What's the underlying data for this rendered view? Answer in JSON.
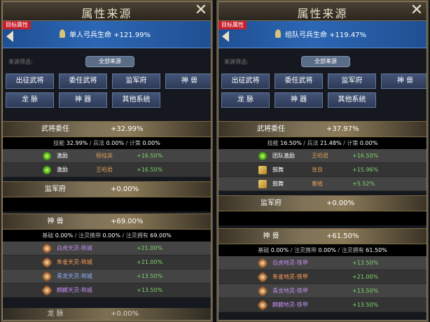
{
  "panels": [
    {
      "title": "属性来源",
      "target_tag": "目标属性",
      "target_stat": "单人弓兵生命 +121.99%",
      "filter_label": "来源筛选:",
      "all_sources": "全部来源",
      "filters": [
        "出征武将",
        "委任武将",
        "监军府",
        "神 兽",
        "龙 脉",
        "神 器",
        "其他系统"
      ],
      "sections": [
        {
          "name": "武将委任",
          "value": "+32.99%",
          "breakdown": [
            "技能",
            "32.99%",
            "/ 兵法",
            "0.00%",
            "/ 计策",
            "0.00%"
          ],
          "rows": [
            {
              "label": "激励",
              "name": "穆桂英",
              "value": "+16.50%",
              "icon": "green",
              "name_color": "orange"
            },
            {
              "label": "激励",
              "name": "王昭君",
              "value": "+16.50%",
              "icon": "green",
              "name_color": "orange"
            }
          ]
        },
        {
          "name": "监军府",
          "value": "+0.00%",
          "breakdown": [],
          "rows": []
        },
        {
          "name": "神 兽",
          "value": "+69.00%",
          "breakdown": [
            "基础",
            "0.00%",
            "/ 注灵携带",
            "0.00%",
            "/ 注灵拥有",
            "69.00%"
          ],
          "rows": [
            {
              "label": "白虎天灵-筑城",
              "name": "",
              "value": "+21.00%",
              "icon": "creature",
              "name_color": "purple"
            },
            {
              "label": "朱雀天灵-筑城",
              "name": "",
              "value": "+21.00%",
              "icon": "creature",
              "name_color": "orange"
            },
            {
              "label": "青龙天灵-筑城",
              "name": "",
              "value": "+13.50%",
              "icon": "creature",
              "name_color": "blue"
            },
            {
              "label": "麒麟天灵-筑城",
              "name": "",
              "value": "+13.50%",
              "icon": "creature",
              "name_color": "purple"
            }
          ]
        },
        {
          "name": "龙 脉",
          "value": "+0.00%",
          "breakdown": [],
          "rows": []
        }
      ]
    },
    {
      "title": "属性来源",
      "target_tag": "目标属性",
      "target_stat": "组队弓兵生命 +119.47%",
      "filter_label": "来源筛选:",
      "all_sources": "全部来源",
      "filters": [
        "出征武将",
        "委任武将",
        "监军府",
        "神 兽",
        "龙 脉",
        "神 器",
        "其他系统"
      ],
      "sections": [
        {
          "name": "武将委任",
          "value": "+37.97%",
          "breakdown": [
            "技能",
            "16.50%",
            "/ 兵法",
            "21.48%",
            "/ 计策",
            "0.00%"
          ],
          "rows": [
            {
              "label": "团队激励",
              "name": "王昭君",
              "value": "+16.50%",
              "icon": "green",
              "name_color": "orange"
            },
            {
              "label": "鼓舞",
              "name": "张良",
              "value": "+15.96%",
              "icon": "alt",
              "name_color": "orange"
            },
            {
              "label": "鼓舞",
              "name": "曹植",
              "value": "+5.52%",
              "icon": "alt",
              "name_color": "orange"
            }
          ]
        },
        {
          "name": "监军府",
          "value": "+0.00%",
          "breakdown": [],
          "rows": []
        },
        {
          "name": "神 兽",
          "value": "+61.50%",
          "breakdown": [
            "基础",
            "0.00%",
            "/ 注灵携带",
            "0.00%",
            "/ 注灵拥有",
            "61.50%"
          ],
          "rows": [
            {
              "label": "白虎地灵-铁甲",
              "name": "",
              "value": "+13.50%",
              "icon": "creature",
              "name_color": "purple"
            },
            {
              "label": "朱雀地灵-铁甲",
              "name": "",
              "value": "+21.00%",
              "icon": "creature",
              "name_color": "orange"
            },
            {
              "label": "青龙地灵-铁甲",
              "name": "",
              "value": "+13.50%",
              "icon": "creature",
              "name_color": "purple"
            },
            {
              "label": "麒麟地灵-铁甲",
              "name": "",
              "value": "+13.50%",
              "icon": "creature",
              "name_color": "purple"
            }
          ]
        }
      ]
    }
  ]
}
